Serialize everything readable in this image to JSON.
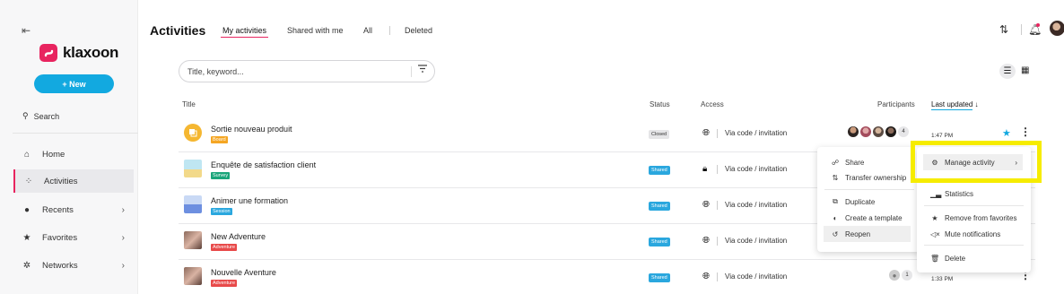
{
  "sidebar": {
    "collapse_icon": "collapse-left-icon",
    "logo_text": "klaxoon",
    "new_button": "+ New",
    "search_label": "Search",
    "items": [
      {
        "label": "Home",
        "icon": "home-icon"
      },
      {
        "label": "Activities",
        "icon": "activities-icon",
        "active": true
      },
      {
        "label": "Recents",
        "icon": "clock-icon",
        "chevron": true
      },
      {
        "label": "Favorites",
        "icon": "star-icon",
        "chevron": true
      },
      {
        "label": "Networks",
        "icon": "network-icon",
        "chevron": true
      }
    ]
  },
  "header": {
    "title": "Activities",
    "tabs": [
      "My activities",
      "Shared with me",
      "All",
      "Deleted"
    ],
    "active_tab": "My activities"
  },
  "search": {
    "placeholder": "Title, keyword..."
  },
  "table": {
    "columns": {
      "title": "Title",
      "status": "Status",
      "access": "Access",
      "participants": "Participants",
      "updated": "Last updated ↓"
    },
    "rows": [
      {
        "title": "Sortie nouveau produit",
        "tag": "Board",
        "tag_color": "#f5a623",
        "status": "Closed",
        "access": "Via code / invitation",
        "updated": "1:47 PM",
        "participants_count": "4",
        "favorite": true
      },
      {
        "title": "Enquête de satisfaction client",
        "tag": "Survey",
        "tag_color": "#1aa57a",
        "status": "Shared",
        "access": "Via code / invitation",
        "updated": "",
        "locked": true
      },
      {
        "title": "Animer une formation",
        "tag": "Session",
        "tag_color": "#2aa7de",
        "status": "Shared",
        "access": "Via code / invitation",
        "updated": ""
      },
      {
        "title": "New Adventure",
        "tag": "Adventure",
        "tag_color": "#e84a4a",
        "status": "Shared",
        "access": "Via code / invitation",
        "updated": ""
      },
      {
        "title": "Nouvelle Aventure",
        "tag": "Adventure",
        "tag_color": "#e84a4a",
        "status": "Shared",
        "access": "Via code / invitation",
        "updated": "1:33 PM",
        "participants_count": "1"
      }
    ]
  },
  "left_menu": {
    "items": [
      "Share",
      "Transfer ownership",
      "Duplicate",
      "Create a template",
      "Reopen"
    ]
  },
  "right_menu": {
    "items": [
      "Manage activity",
      "Statistics",
      "Remove from favorites",
      "Mute notifications",
      "Delete"
    ]
  },
  "colors": {
    "accent": "#e8245f",
    "primary": "#12a9e0",
    "highlight": "#f6ec00"
  }
}
